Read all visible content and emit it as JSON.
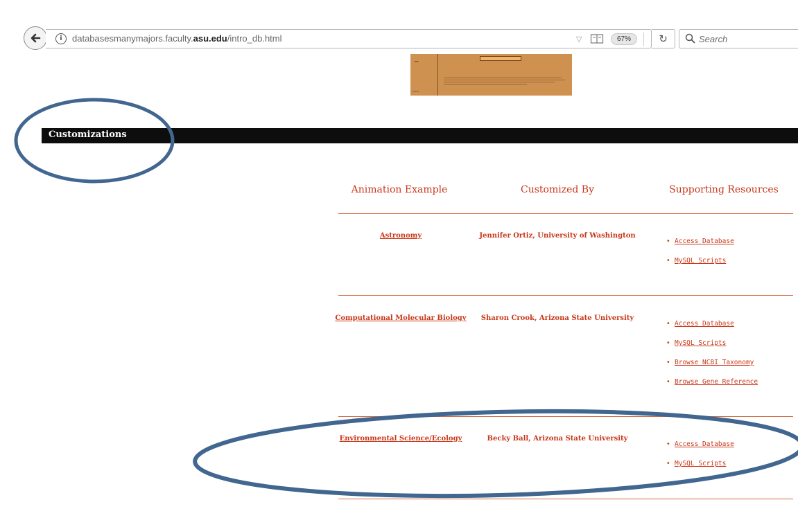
{
  "browser": {
    "url_prefix": "databasesmanymajors.faculty.",
    "url_domain": "asu.edu",
    "url_path": "/intro_db.html",
    "zoom": "67%",
    "search_placeholder": "Search"
  },
  "section": {
    "title": "Customizations"
  },
  "table": {
    "headers": [
      "Animation Example",
      "Customized By",
      "Supporting Resources"
    ],
    "rows": [
      {
        "example": "Astronomy",
        "customized_by": "Jennifer Ortiz, University of Washington",
        "resources": [
          "Access Database",
          "MySQL Scripts"
        ]
      },
      {
        "example": "Computational Molecular Biology",
        "customized_by": "Sharon Crook, Arizona State University",
        "resources": [
          "Access Database",
          "MySQL Scripts",
          "Browse NCBI Taxonomy",
          "Browse Gene Reference"
        ]
      },
      {
        "example": "Environmental Science/Ecology",
        "customized_by": "Becky Ball, Arizona State University",
        "resources": [
          "Access Database",
          "MySQL Scripts"
        ]
      }
    ]
  },
  "colors": {
    "accent": "#c9381a",
    "rule": "#d06a3f",
    "annotation": "#41668f",
    "preview_bg": "#cf9150"
  }
}
